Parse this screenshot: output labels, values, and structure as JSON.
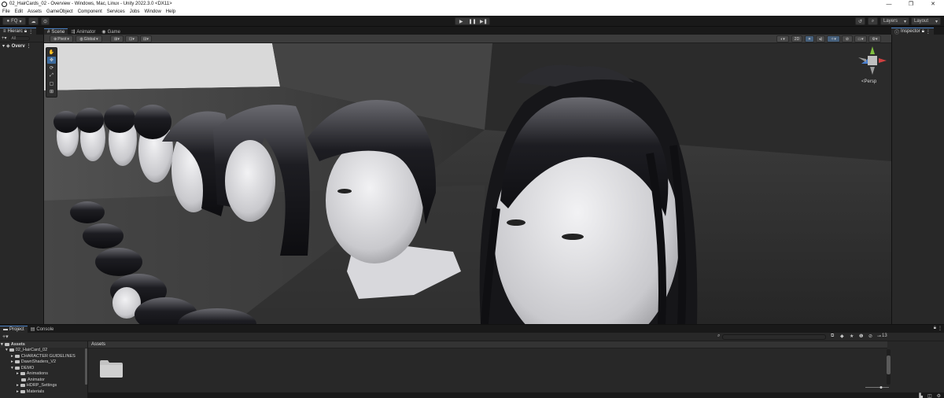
{
  "window": {
    "title": "02_HairCards_02 - Overview - Windows, Mac, Linux - Unity 2022.3.0 <DX11>",
    "minimize": "—",
    "maximize": "❐",
    "close": "✕"
  },
  "menu": [
    "File",
    "Edit",
    "Assets",
    "GameObject",
    "Component",
    "Services",
    "Jobs",
    "Window",
    "Help"
  ],
  "toolbar": {
    "account": "FQ",
    "layers": "Layers",
    "layout": "Layout"
  },
  "hierarchy": {
    "tab": "Hierarc",
    "search_placeholder": "All",
    "root_item": "Overv"
  },
  "scene": {
    "tabs": [
      "Scene",
      "Animator",
      "Game"
    ],
    "pivot": "Pivot",
    "global": "Global",
    "mode_2d": "2D",
    "persp_label": "<Persp"
  },
  "inspector": {
    "tab": "Inspector"
  },
  "bottom": {
    "tabs": [
      "Project",
      "Console"
    ],
    "tree_header": "Assets",
    "tree": [
      {
        "label": "Assets",
        "depth": 0,
        "expanded": true,
        "header": true
      },
      {
        "label": "02_HairCard_02",
        "depth": 1,
        "expanded": true,
        "header": false
      },
      {
        "label": "CHARACTER GUIDELINES",
        "depth": 2,
        "expanded": false,
        "header": false
      },
      {
        "label": "DawnShaders_V2",
        "depth": 2,
        "expanded": false,
        "header": false
      },
      {
        "label": "DEMO",
        "depth": 2,
        "expanded": true,
        "header": false
      },
      {
        "label": "Animations",
        "depth": 3,
        "expanded": false,
        "header": false
      },
      {
        "label": "Animator",
        "depth": 3,
        "expanded": false,
        "header": false
      },
      {
        "label": "HDRP_Settings",
        "depth": 3,
        "expanded": false,
        "header": false
      },
      {
        "label": "Materials",
        "depth": 3,
        "expanded": false,
        "header": false
      }
    ],
    "assets_header": "Assets",
    "hidden_count": "13"
  },
  "icons": {
    "play": "play-icon",
    "pause": "pause-icon",
    "step": "step-icon",
    "lock": "lock-icon",
    "menu": "kebab-menu-icon",
    "folder": "folder-icon"
  }
}
